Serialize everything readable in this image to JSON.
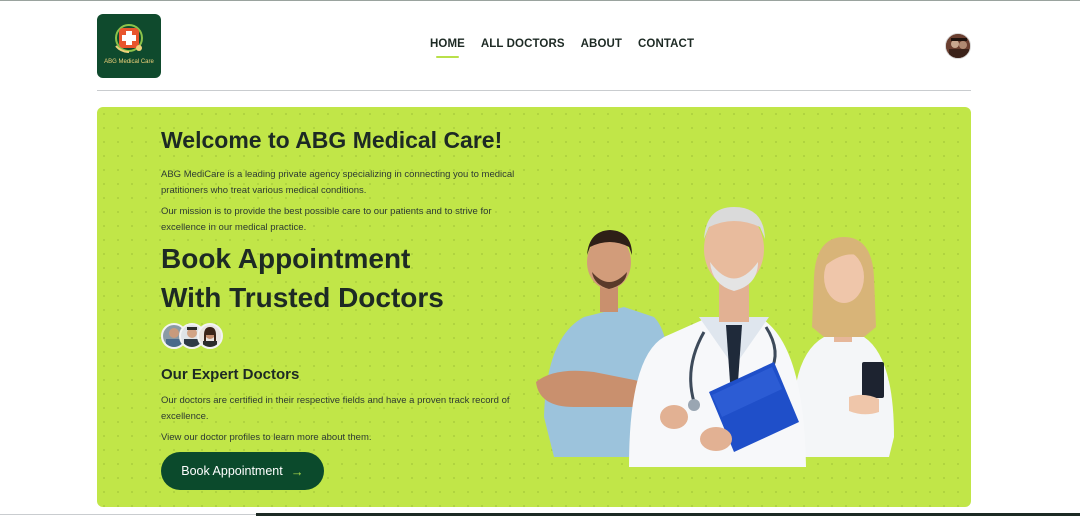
{
  "logo": {
    "text": "ABG Medical Care"
  },
  "nav": {
    "items": [
      {
        "label": "HOME",
        "active": true
      },
      {
        "label": "ALL DOCTORS"
      },
      {
        "label": "ABOUT"
      },
      {
        "label": "CONTACT"
      }
    ]
  },
  "hero": {
    "welcome": "Welcome to ABG Medical Care!",
    "intro": "ABG MediCare is a leading private agency specializing in connecting you to medical pratitioners who treat various medical conditions.",
    "mission": "Our mission is to provide the best possible care to our patients and to strive for excellence in our medical practice.",
    "book_line1": "Book Appointment",
    "book_line2": "With Trusted Doctors",
    "expert_title": "Our Expert Doctors",
    "expert_text": "Our doctors are certified in their respective fields and have a proven track record of excellence.",
    "profiles_text": "View our doctor profiles to learn more about them.",
    "button_label": "Book Appointment"
  },
  "colors": {
    "hero_bg": "#c1e648",
    "brand_dark": "#0b4a2c",
    "accent": "#b9e04a"
  },
  "icons": {
    "logo": "medical-cross-logo-icon",
    "avatar": "user-avatar-icon",
    "button_arrow": "arrow-right-icon"
  }
}
